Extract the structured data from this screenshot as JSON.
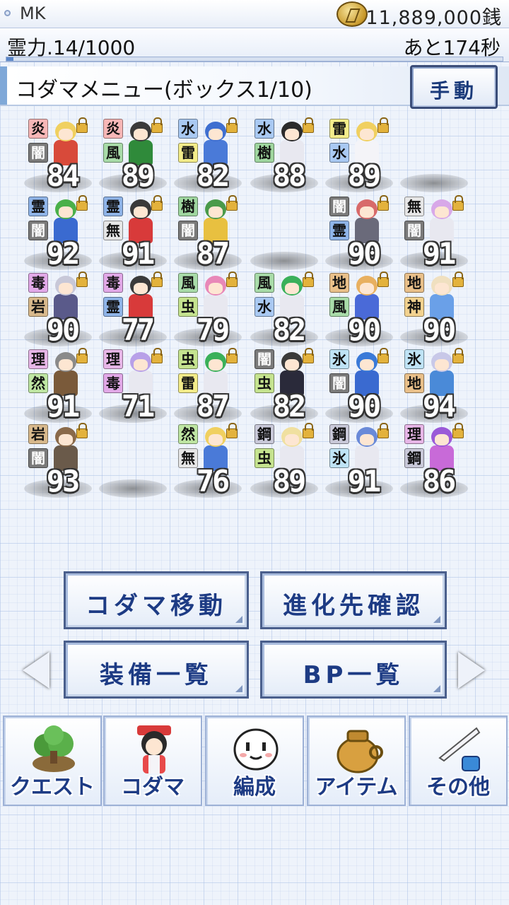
{
  "status": {
    "user_name": "MK",
    "money": "11,889,000銭"
  },
  "power": {
    "label": "霊力.14/1000",
    "timer": "あと174秒",
    "fill_fraction": 0.014
  },
  "header": {
    "title": "コダマメニュー(ボックス1/10)",
    "manual_button": "手動"
  },
  "type_colors": {
    "炎": "#f7b7b7",
    "闇": "#7a7a7a",
    "風": "#a9dca9",
    "水": "#a9c9f2",
    "雷": "#f3ec8a",
    "樹": "#9fd69f",
    "霊": "#8fb4e8",
    "無": "#e6e6e6",
    "毒": "#e2a9e8",
    "岩": "#d8b98c",
    "虫": "#c5e38f",
    "地": "#e9c08a",
    "神": "#f2d28f",
    "理": "#e8b7e8",
    "然": "#bfe6a3",
    "氷": "#bfe3f5",
    "鋼": "#c9c9d9"
  },
  "box": {
    "rows": [
      [
        {
          "t1": "炎",
          "t2": "闇",
          "level": "84",
          "hair": "#f0d060",
          "outfit": "#d84a3a"
        },
        {
          "t1": "炎",
          "t2": "風",
          "level": "89",
          "hair": "#3a3a3a",
          "outfit": "#2f8a3a"
        },
        {
          "t1": "水",
          "t2": "雷",
          "level": "82",
          "hair": "#3f6fd0",
          "outfit": "#4a7ad8"
        },
        {
          "t1": "水",
          "t2": "樹",
          "level": "88",
          "hair": "#2a2a2a",
          "outfit": "#e8e8f0"
        },
        {
          "t1": "雷",
          "t2": "水",
          "level": "89",
          "hair": "#f0d060",
          "outfit": "#f4f4f8"
        },
        null
      ],
      [
        {
          "t1": "霊",
          "t2": "闇",
          "level": "92",
          "hair": "#4ab04a",
          "outfit": "#3a6ad0"
        },
        {
          "t1": "霊",
          "t2": "無",
          "level": "91",
          "hair": "#3a3a3a",
          "outfit": "#d83a3a"
        },
        {
          "t1": "樹",
          "t2": "闇",
          "level": "87",
          "hair": "#4a9a4a",
          "outfit": "#e8c040"
        },
        null,
        {
          "t1": "闇",
          "t2": "霊",
          "level": "90",
          "hair": "#d86a6a",
          "outfit": "#6a6a7a"
        },
        {
          "t1": "無",
          "t2": "闇",
          "level": "91",
          "hair": "#d8a8e8",
          "outfit": "#e8e8f0"
        }
      ],
      [
        {
          "t1": "毒",
          "t2": "岩",
          "level": "90",
          "hair": "#c8c8d8",
          "outfit": "#5a5a8a"
        },
        {
          "t1": "毒",
          "t2": "霊",
          "level": "77",
          "hair": "#3a3a3a",
          "outfit": "#d83a3a"
        },
        {
          "t1": "風",
          "t2": "虫",
          "level": "79",
          "hair": "#e888b8",
          "outfit": "#e8e8f0"
        },
        {
          "t1": "風",
          "t2": "水",
          "level": "82",
          "hair": "#3ab05a",
          "outfit": "#e8e8f0"
        },
        {
          "t1": "地",
          "t2": "風",
          "level": "90",
          "hair": "#e8b060",
          "outfit": "#4a6ad8"
        },
        {
          "t1": "地",
          "t2": "神",
          "level": "90",
          "hair": "#f0e0c0",
          "outfit": "#6aa0e8"
        }
      ],
      [
        {
          "t1": "理",
          "t2": "然",
          "level": "91",
          "hair": "#8a8a8a",
          "outfit": "#7a5a3a"
        },
        {
          "t1": "理",
          "t2": "毒",
          "level": "71",
          "hair": "#b8a0e8",
          "outfit": "#e8e8f0"
        },
        {
          "t1": "虫",
          "t2": "雷",
          "level": "87",
          "hair": "#3ab05a",
          "outfit": "#e8e8f0"
        },
        {
          "t1": "闇",
          "t2": "虫",
          "level": "82",
          "hair": "#3a3a3a",
          "outfit": "#2a2a3a"
        },
        {
          "t1": "氷",
          "t2": "闇",
          "level": "90",
          "hair": "#3a7ad8",
          "outfit": "#3a6ad0"
        },
        {
          "t1": "氷",
          "t2": "地",
          "level": "94",
          "hair": "#c8c8e8",
          "outfit": "#4a8ad8"
        }
      ],
      [
        {
          "t1": "岩",
          "t2": "闇",
          "level": "93",
          "hair": "#8a6a4a",
          "outfit": "#6a5a4a"
        },
        null,
        {
          "t1": "然",
          "t2": "無",
          "level": "76",
          "hair": "#f0d060",
          "outfit": "#4a7ad8"
        },
        {
          "t1": "鋼",
          "t2": "虫",
          "level": "89",
          "hair": "#f0e0a0",
          "outfit": "#e8e8f0"
        },
        {
          "t1": "鋼",
          "t2": "氷",
          "level": "91",
          "hair": "#6a8ad8",
          "outfit": "#e8e8f0"
        },
        {
          "t1": "理",
          "t2": "鋼",
          "level": "86",
          "hair": "#9a5ad8",
          "outfit": "#c86ad8"
        }
      ]
    ]
  },
  "menu": {
    "move": "コダマ移動",
    "evolve": "進化先確認",
    "equip": "装備一覧",
    "bp": "BP一覧"
  },
  "nav": {
    "quest": "クエスト",
    "kodama": "コダマ",
    "formation": "編成",
    "item": "アイテム",
    "other": "その他"
  }
}
